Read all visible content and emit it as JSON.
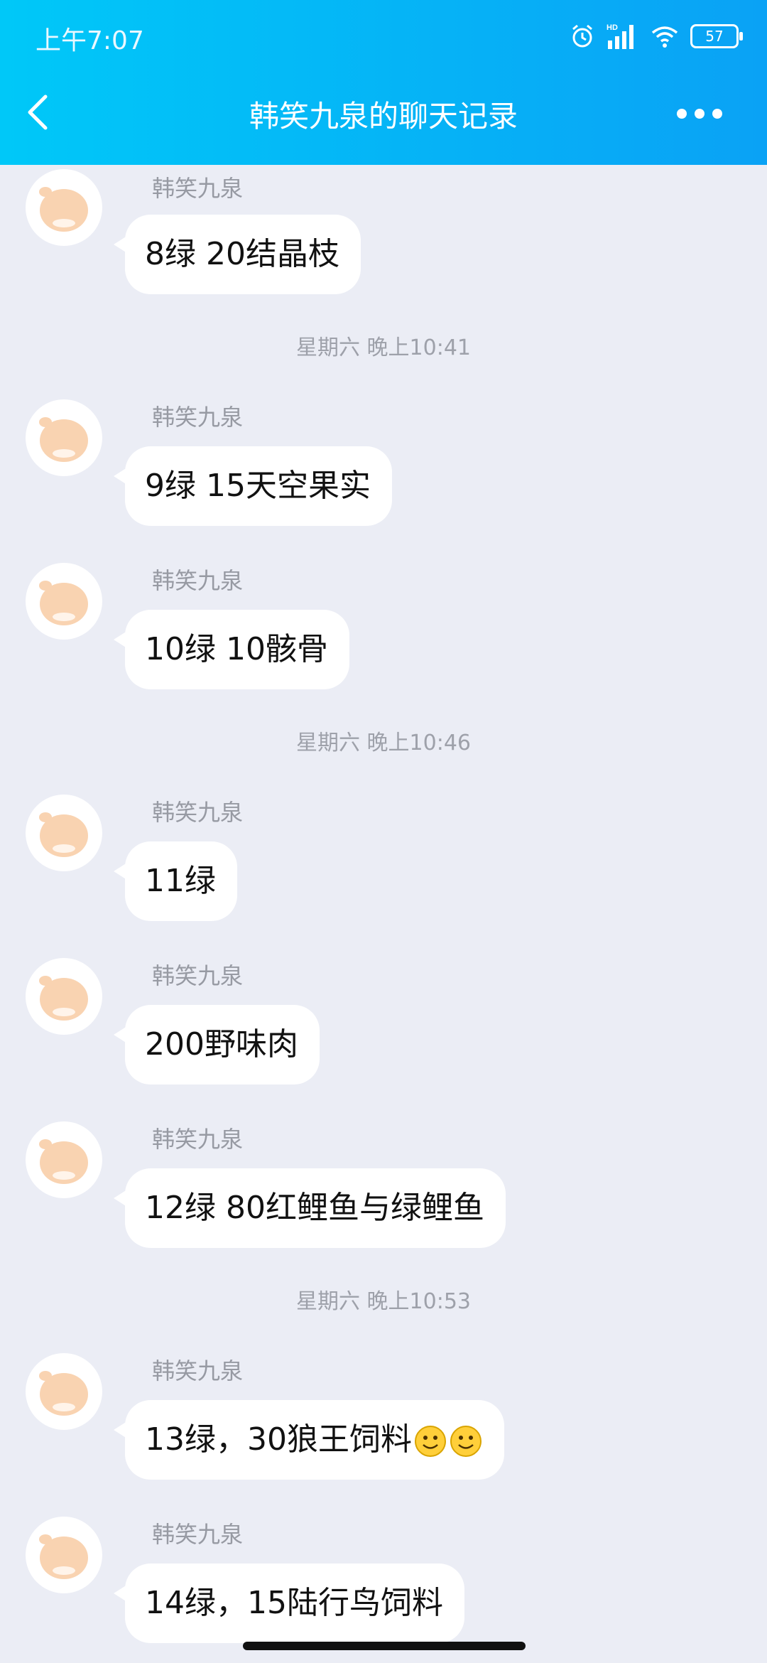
{
  "status_bar": {
    "time": "上午7:07",
    "battery": "57",
    "network": "HD"
  },
  "header": {
    "title": "韩笑九泉的聊天记录"
  },
  "sender_name": "韩笑九泉",
  "timestamps": [
    "星期六 晚上10:41",
    "星期六 晚上10:46",
    "星期六 晚上10:53"
  ],
  "messages": [
    {
      "sender": "韩笑九泉",
      "text": "8绿 20结晶枝"
    },
    {
      "sender": "韩笑九泉",
      "text": "9绿 15天空果实"
    },
    {
      "sender": "韩笑九泉",
      "text": "10绿 10骸骨"
    },
    {
      "sender": "韩笑九泉",
      "text": "11绿"
    },
    {
      "sender": "韩笑九泉",
      "text": "200野味肉"
    },
    {
      "sender": "韩笑九泉",
      "text": "12绿 80红鲤鱼与绿鲤鱼"
    },
    {
      "sender": "韩笑九泉",
      "text": "13绿，30狼王饲料",
      "emojis": [
        "smile-emoji",
        "smile-emoji"
      ]
    },
    {
      "sender": "韩笑九泉",
      "text": "14绿，15陆行鸟饲料"
    }
  ],
  "colors": {
    "header_start": "#00c8f8",
    "header_end": "#0aa2f5",
    "background": "#ebedf5",
    "bubble": "#ffffff"
  }
}
